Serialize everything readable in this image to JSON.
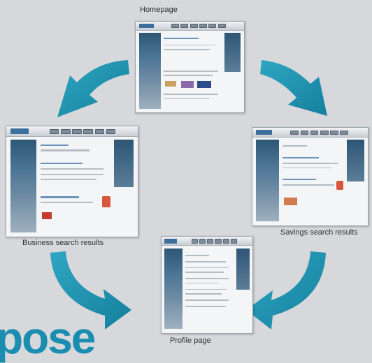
{
  "nodes": {
    "homepage": "Homepage",
    "business_search_results": "Business search results",
    "savings_search_results": "Savings search results",
    "profile_page": "Profile page"
  },
  "brand_partial_text": "pose",
  "colors": {
    "background": "#d6d8db",
    "arrow": "#1d8eab",
    "page_accent": "#2e5675"
  }
}
